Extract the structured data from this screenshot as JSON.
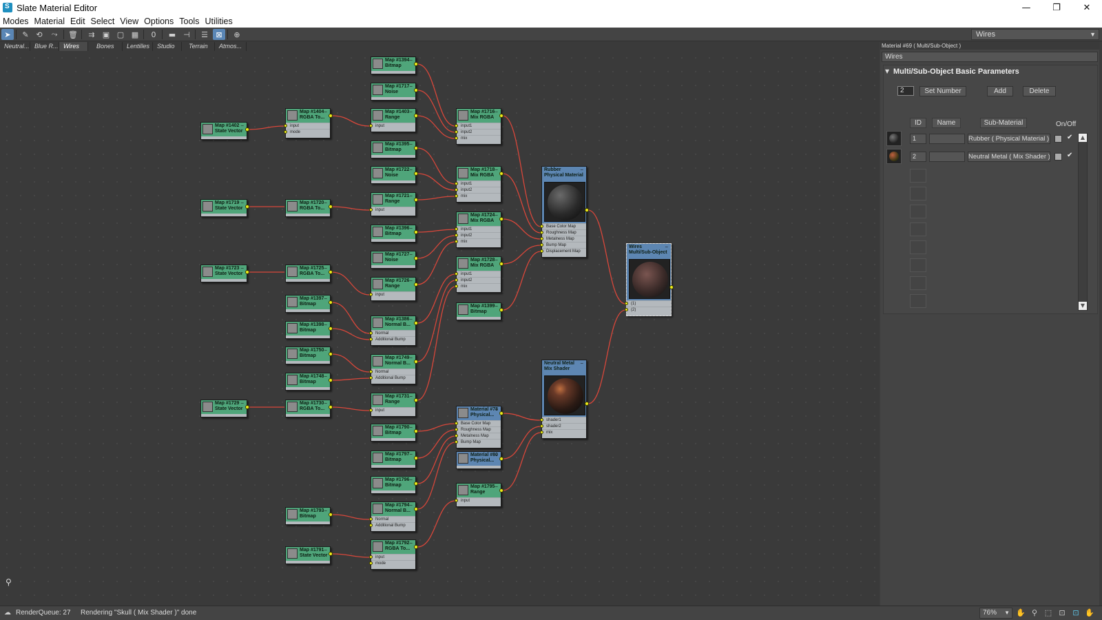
{
  "window": {
    "title": "Slate Material Editor",
    "controls": [
      "—",
      "❐",
      "✕"
    ]
  },
  "menu": [
    "Modes",
    "Material",
    "Edit",
    "Select",
    "View",
    "Options",
    "Tools",
    "Utilities"
  ],
  "toolbar": {
    "view_dropdown": "Wires",
    "icons": [
      "select-tool-icon",
      "pick-material-icon",
      "put-material-icon",
      "assign-material-icon",
      "delete-icon",
      "move-children-icon",
      "hide-unused-icon",
      "layout-all-icon",
      "layout-children-icon",
      "material-id-icon",
      "show-map-icon",
      "show-background-icon",
      "show-end-result-icon",
      "lay-out-icon",
      "lay-out-children-icon",
      "navigator-icon",
      "parameter-editor-icon"
    ]
  },
  "tabs": [
    "Neutral...",
    "Blue R...",
    "Wires",
    "Bones",
    "Lentilles",
    "Studio",
    "Terrain",
    "Atmos..."
  ],
  "active_tab": "Wires",
  "nodes": [
    {
      "id": "n1394",
      "title": "Map #1394",
      "sub": "Bitmap"
    },
    {
      "id": "n1717",
      "title": "Map #1717",
      "sub": "Noise"
    },
    {
      "id": "n1402",
      "title": "Map #1402",
      "sub": "State Vector"
    },
    {
      "id": "n1404",
      "title": "Map #1404",
      "sub": "RGBA To...",
      "slots": [
        "input",
        "mode"
      ]
    },
    {
      "id": "n1403",
      "title": "Map #1403",
      "sub": "Range",
      "slots": [
        "input"
      ]
    },
    {
      "id": "n1716",
      "title": "Map #1716",
      "sub": "Mix RGBA",
      "slots": [
        "input1",
        "input2",
        "mix"
      ]
    },
    {
      "id": "n1395",
      "title": "Map #1395",
      "sub": "Bitmap"
    },
    {
      "id": "n1722",
      "title": "Map #1722",
      "sub": "Noise"
    },
    {
      "id": "n1718",
      "title": "Map #1718",
      "sub": "Mix RGBA",
      "slots": [
        "input1",
        "input2",
        "mix"
      ]
    },
    {
      "id": "n1719",
      "title": "Map #1719",
      "sub": "State Vector"
    },
    {
      "id": "n1720",
      "title": "Map #1720",
      "sub": "RGBA To..."
    },
    {
      "id": "n1721",
      "title": "Map #1721",
      "sub": "Range",
      "slots": [
        "input"
      ]
    },
    {
      "id": "n1396",
      "title": "Map #1396",
      "sub": "Bitmap"
    },
    {
      "id": "n1724",
      "title": "Map #1724",
      "sub": "Mix RGBA",
      "slots": [
        "input1",
        "input2",
        "mix"
      ]
    },
    {
      "id": "n1727",
      "title": "Map #1727",
      "sub": "Noise"
    },
    {
      "id": "n1723",
      "title": "Map #1723",
      "sub": "State Vector"
    },
    {
      "id": "n1725",
      "title": "Map #1725",
      "sub": "RGBA To..."
    },
    {
      "id": "n1726",
      "title": "Map #1726",
      "sub": "Range",
      "slots": [
        "input"
      ]
    },
    {
      "id": "n1728",
      "title": "Map #1728",
      "sub": "Mix RGBA",
      "slots": [
        "input1",
        "input2",
        "mix"
      ]
    },
    {
      "id": "n1397",
      "title": "Map #1397",
      "sub": "Bitmap"
    },
    {
      "id": "n1399",
      "title": "Map #1399",
      "sub": "Bitmap"
    },
    {
      "id": "n1398",
      "title": "Map #1398",
      "sub": "Bitmap"
    },
    {
      "id": "n1386",
      "title": "Map #1386",
      "sub": "Normal B...",
      "slots": [
        "Normal",
        "Additional Bump"
      ]
    },
    {
      "id": "n1750",
      "title": "Map #1750",
      "sub": "Bitmap"
    },
    {
      "id": "n1749",
      "title": "Map #1749",
      "sub": "Normal B...",
      "slots": [
        "Normal",
        "Additional Bump"
      ]
    },
    {
      "id": "n1748",
      "title": "Map #1748",
      "sub": "Bitmap"
    },
    {
      "id": "n1729",
      "title": "Map #1729",
      "sub": "State Vector"
    },
    {
      "id": "n1730",
      "title": "Map #1730",
      "sub": "RGBA To..."
    },
    {
      "id": "n1731",
      "title": "Map #1731",
      "sub": "Range",
      "slots": [
        "input"
      ]
    },
    {
      "id": "n1790",
      "title": "Map #1790",
      "sub": "Bitmap"
    },
    {
      "id": "n1797",
      "title": "Map #1797",
      "sub": "Bitmap"
    },
    {
      "id": "n1796",
      "title": "Map #1796",
      "sub": "Bitmap"
    },
    {
      "id": "n1793",
      "title": "Map #1793",
      "sub": "Bitmap"
    },
    {
      "id": "n1794",
      "title": "Map #1794",
      "sub": "Normal B...",
      "slots": [
        "Normal",
        "Additional Bump"
      ]
    },
    {
      "id": "n1791",
      "title": "Map #1791",
      "sub": "State Vector"
    },
    {
      "id": "n1792",
      "title": "Map #1792",
      "sub": "RGBA To...",
      "slots": [
        "input",
        "mode"
      ]
    },
    {
      "id": "n1795",
      "title": "Map #1795",
      "sub": "Range",
      "slots": [
        "input"
      ]
    },
    {
      "id": "m78",
      "title": "Material #78",
      "sub": "Physical...",
      "slots": [
        "Base Color Map",
        "Roughness Map",
        "Metalness Map",
        "Bump Map"
      ]
    },
    {
      "id": "m80",
      "title": "Material #80",
      "sub": "Physical..."
    },
    {
      "id": "rubber",
      "title": "Rubber",
      "sub": "Physical Material",
      "slots": [
        "Base Color Map",
        "Roughness Map",
        "Metalness Map",
        "Bump Map",
        "Displacement Map"
      ]
    },
    {
      "id": "metal",
      "title": "Neutral Metal",
      "sub": "Mix Shader",
      "slots": [
        "shader1",
        "shader2",
        "mix"
      ]
    },
    {
      "id": "wires",
      "title": "Wires",
      "sub": "Multi/Sub-Object",
      "slots": [
        "(1)",
        "(2)"
      ]
    }
  ],
  "panel": {
    "header": "Material #69  ( Multi/Sub-Object )",
    "name_field": "Wires",
    "rollout_title": "Multi/Sub-Object Basic Parameters",
    "set_number_value": "2",
    "set_number_label": "Set Number",
    "add_label": "Add",
    "delete_label": "Delete",
    "col_id": "ID",
    "col_name": "Name",
    "col_sub_material": "Sub-Material",
    "col_onoff": "On/Off",
    "rows": [
      {
        "id": "1",
        "name": "",
        "sub_material": "Rubber  ( Physical Material )",
        "on": "✔"
      },
      {
        "id": "2",
        "name": "",
        "sub_material": "Neutral Metal  ( Mix Shader )",
        "on": "✔"
      }
    ]
  },
  "status": {
    "queue": "RenderQueue: 27",
    "message": "Rendering \"Skull  ( Mix Shader )\" done",
    "zoom": "76%"
  }
}
